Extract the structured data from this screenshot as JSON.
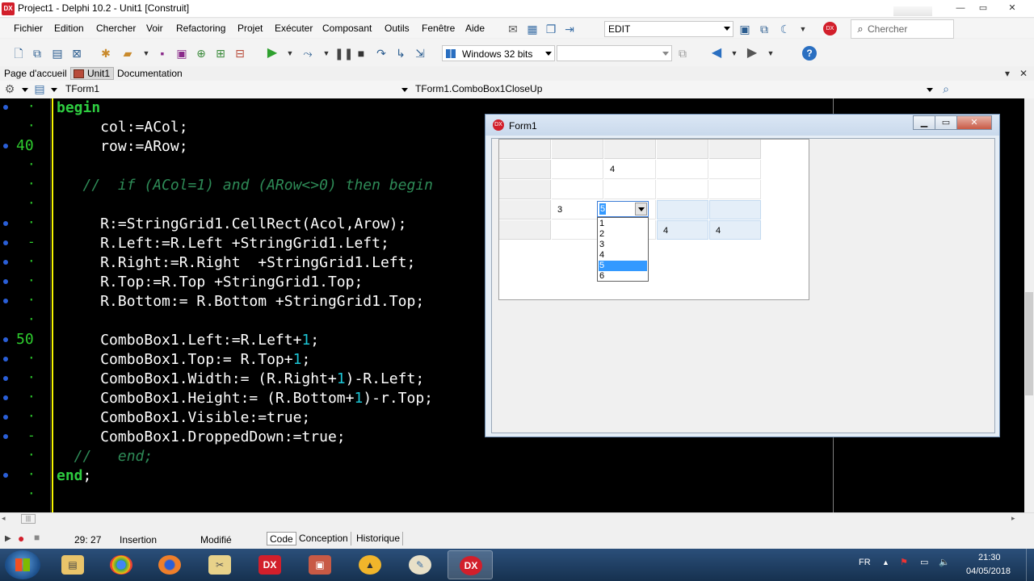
{
  "window": {
    "title": "Project1 - Delphi 10.2 - Unit1 [Construit]",
    "app_icon_label": "DX",
    "controls": {
      "minimize": "—",
      "maximize": "▭",
      "close": "✕"
    }
  },
  "menubar": {
    "items": [
      "Fichier",
      "Edition",
      "Chercher",
      "Voir",
      "Refactoring",
      "Projet",
      "Exécuter",
      "Composant",
      "Outils",
      "Fenêtre",
      "Aide"
    ],
    "layout_combo": "EDIT",
    "search_placeholder": "Chercher"
  },
  "toolbar": {
    "platform": "Windows 32 bits",
    "config": ""
  },
  "tabs": {
    "items": [
      "Page d'accueil",
      "Unit1",
      "Documentation"
    ],
    "active": "Unit1"
  },
  "selectors": {
    "class": "TForm1",
    "method": "TForm1.ComboBox1CloseUp"
  },
  "editor": {
    "gutter": [
      {
        "dot": true,
        "mark": "·"
      },
      {
        "dot": false,
        "mark": "·"
      },
      {
        "dot": true,
        "mark": "",
        "num": "40"
      },
      {
        "dot": false,
        "mark": "·"
      },
      {
        "dot": false,
        "mark": "·"
      },
      {
        "dot": false,
        "mark": "·"
      },
      {
        "dot": true,
        "mark": "·"
      },
      {
        "dot": true,
        "mark": "-"
      },
      {
        "dot": true,
        "mark": "·"
      },
      {
        "dot": true,
        "mark": "·"
      },
      {
        "dot": true,
        "mark": "·"
      },
      {
        "dot": false,
        "mark": "·"
      },
      {
        "dot": true,
        "mark": "",
        "num": "50"
      },
      {
        "dot": true,
        "mark": "·"
      },
      {
        "dot": true,
        "mark": "·"
      },
      {
        "dot": true,
        "mark": "·"
      },
      {
        "dot": true,
        "mark": "·"
      },
      {
        "dot": true,
        "mark": "-"
      },
      {
        "dot": false,
        "mark": "·"
      },
      {
        "dot": true,
        "mark": "·"
      },
      {
        "dot": false,
        "mark": "·"
      }
    ],
    "lines": [
      [
        {
          "t": "begin",
          "c": "kw"
        }
      ],
      [
        {
          "t": "     col:=ACol;",
          "c": ""
        }
      ],
      [
        {
          "t": "     row:=ARow;",
          "c": ""
        }
      ],
      [
        {
          "t": "",
          "c": ""
        }
      ],
      [
        {
          "t": "   //  if (ACol=1) and (ARow<>0) then begin",
          "c": "cm"
        }
      ],
      [
        {
          "t": "",
          "c": ""
        }
      ],
      [
        {
          "t": "     R:=StringGrid1.CellRect(Acol,Arow);",
          "c": ""
        }
      ],
      [
        {
          "t": "     R.Left:=R.Left +StringGrid1.Left;",
          "c": ""
        }
      ],
      [
        {
          "t": "     R.Right:=R.Right  +StringGrid1.Left;",
          "c": ""
        }
      ],
      [
        {
          "t": "     R.Top:=R.Top +StringGrid1.Top;",
          "c": ""
        }
      ],
      [
        {
          "t": "     R.Bottom:= R.Bottom +StringGrid1.Top;",
          "c": ""
        }
      ],
      [
        {
          "t": "",
          "c": ""
        }
      ],
      [
        {
          "t": "     ComboBox1.Left:=R.Left+",
          "c": ""
        },
        {
          "t": "1",
          "c": "nm"
        },
        {
          "t": ";",
          "c": ""
        }
      ],
      [
        {
          "t": "     ComboBox1.Top:= R.Top+",
          "c": ""
        },
        {
          "t": "1",
          "c": "nm"
        },
        {
          "t": ";",
          "c": ""
        }
      ],
      [
        {
          "t": "     ComboBox1.Width:= (R.Right+",
          "c": ""
        },
        {
          "t": "1",
          "c": "nm"
        },
        {
          "t": ")-R.Left;",
          "c": ""
        }
      ],
      [
        {
          "t": "     ComboBox1.Height:= (R.Bottom+",
          "c": ""
        },
        {
          "t": "1",
          "c": "nm"
        },
        {
          "t": ")-r.Top;",
          "c": ""
        }
      ],
      [
        {
          "t": "     ComboBox1.Visible:=true;",
          "c": ""
        }
      ],
      [
        {
          "t": "     ComboBox1.DroppedDown:=true;",
          "c": ""
        }
      ],
      [
        {
          "t": "  //   end;",
          "c": "cm"
        }
      ],
      [
        {
          "t": "end",
          "c": "kw"
        },
        {
          "t": ";",
          "c": ""
        }
      ],
      [
        {
          "t": "",
          "c": ""
        }
      ]
    ]
  },
  "status": {
    "position": "29: 27",
    "mode": "Insertion",
    "modified": "Modifié",
    "tabs": [
      "Code",
      "Conception",
      "Historique"
    ]
  },
  "form1": {
    "title": "Form1",
    "icon_label": "DX",
    "grid": {
      "rows": [
        [
          "",
          "",
          "",
          "",
          ""
        ],
        [
          "",
          "",
          "4",
          "",
          ""
        ],
        [
          "",
          "",
          "",
          "",
          ""
        ],
        [
          "",
          "3",
          "",
          "",
          ""
        ],
        [
          "",
          "",
          "",
          "4",
          "4"
        ]
      ]
    },
    "combo": {
      "value": "5",
      "options": [
        "1",
        "2",
        "3",
        "4",
        "5",
        "6"
      ],
      "highlighted": "5"
    }
  },
  "taskbar": {
    "apps": [
      "explorer",
      "chrome",
      "firefox",
      "tools",
      "delphi-dx",
      "package",
      "warning",
      "paint",
      "delphi-dx-active"
    ],
    "lang": "FR",
    "time": "21:30",
    "date": "04/05/2018"
  }
}
